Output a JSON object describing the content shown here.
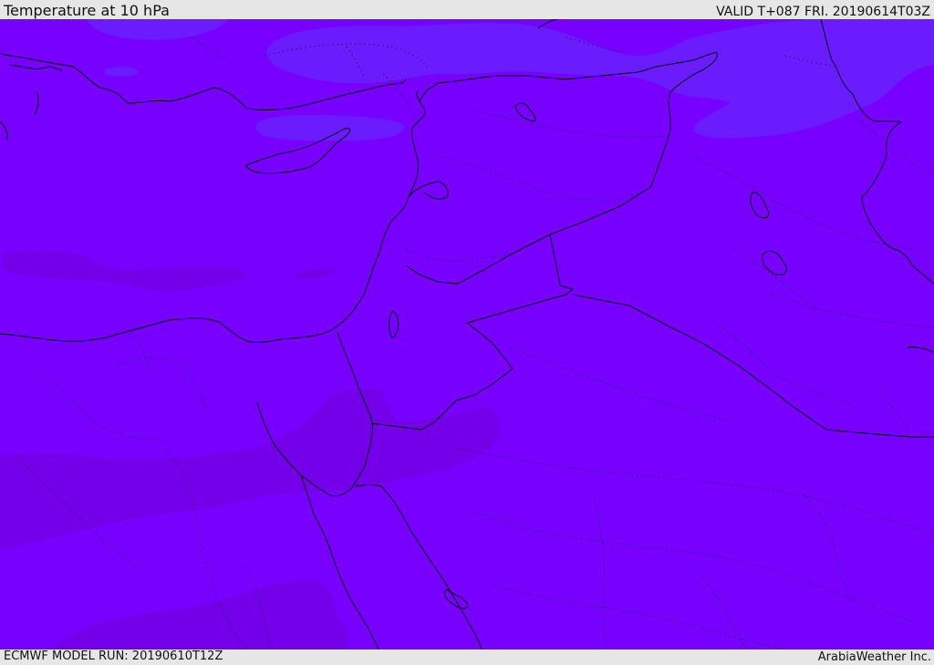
{
  "header": {
    "title": "Temperature at 10 hPa",
    "valid": "VALID T+087 FRI. 20190614T03Z"
  },
  "footer": {
    "model_run": "ECMWF MODEL RUN: 20190610T12Z",
    "credit": "ArabiaWeather Inc."
  },
  "colors": {
    "background_field": "#7700ff",
    "cold_shade": "#6a1cff",
    "warm_shade": "#7300e8",
    "coastline": "#000000",
    "border": "#000000",
    "admin_border": "#3a1780",
    "panel": "#e6e6e6"
  }
}
